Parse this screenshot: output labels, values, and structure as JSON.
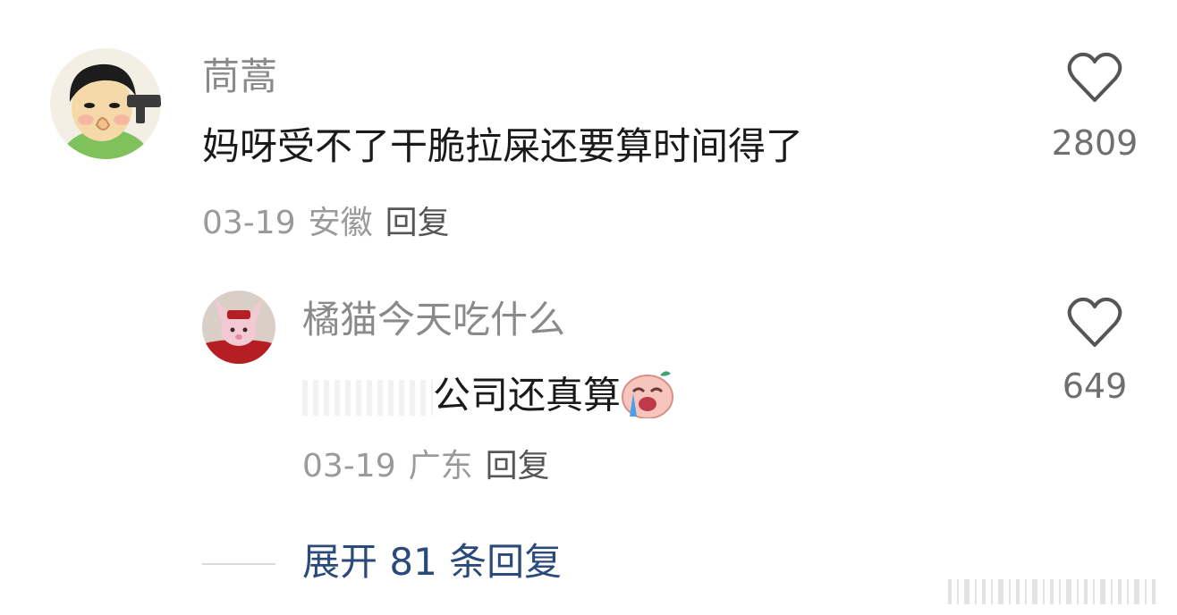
{
  "comments": [
    {
      "username": "茼蒿",
      "text": "妈呀受不了干脆拉屎还要算时间得了",
      "date": "03-19",
      "region": "安徽",
      "reply_label": "回复",
      "likes": "2809"
    }
  ],
  "reply": {
    "username": "橘猫今天吃什么",
    "text_visible": "公司还真算",
    "date": "03-19",
    "region": "广东",
    "reply_label": "回复",
    "likes": "649"
  },
  "expand_label": "展开 81 条回复"
}
